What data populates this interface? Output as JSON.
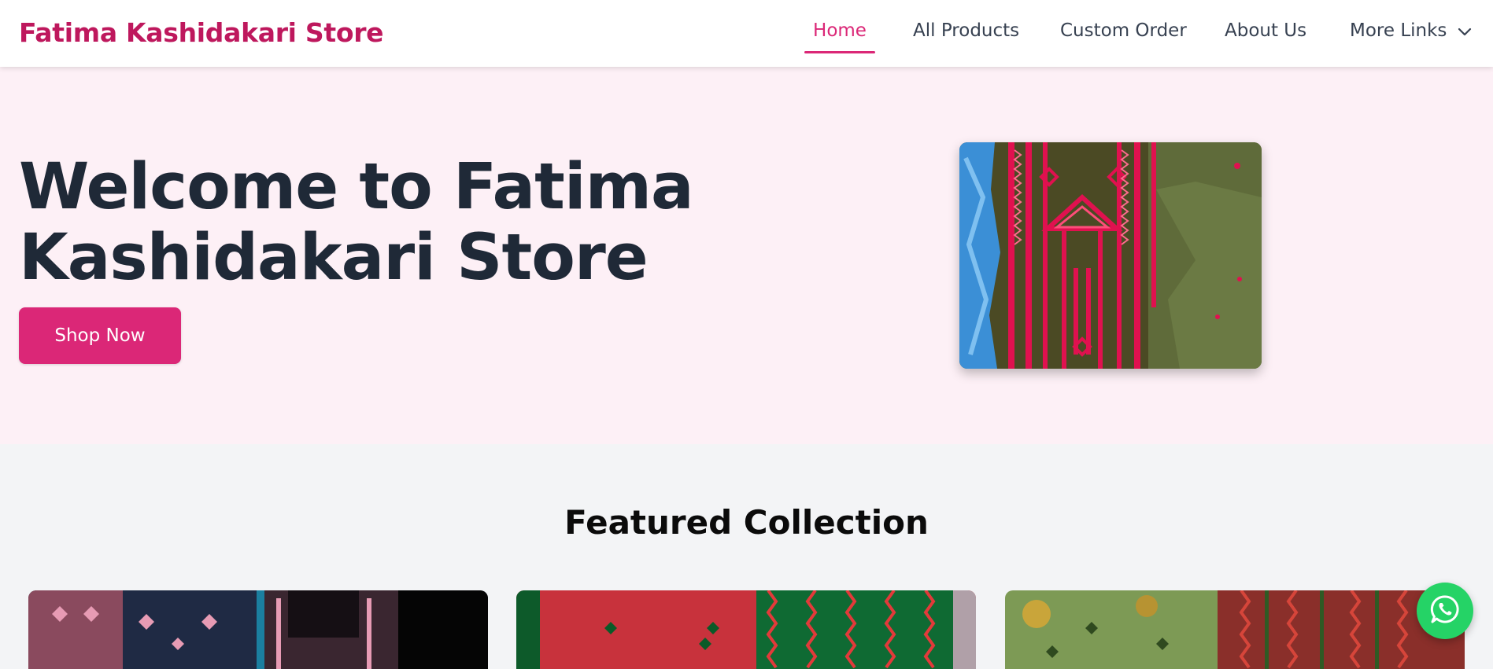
{
  "header": {
    "brand": "Fatima Kashidakari Store",
    "nav": {
      "home": "Home",
      "all_products": "All Products",
      "custom_order": "Custom Order",
      "about_us": "About Us",
      "more_links": "More Links"
    }
  },
  "hero": {
    "title": "Welcome to Fatima Kashidakari Store",
    "cta": "Shop Now"
  },
  "featured": {
    "title": "Featured Collection"
  },
  "colors": {
    "brand": "#be185d",
    "accent": "#db2777",
    "hero_bg": "#fdf0f6",
    "whatsapp": "#25d366"
  },
  "icons": {
    "dropdown": "chevron-down-icon",
    "whatsapp": "whatsapp-icon"
  }
}
